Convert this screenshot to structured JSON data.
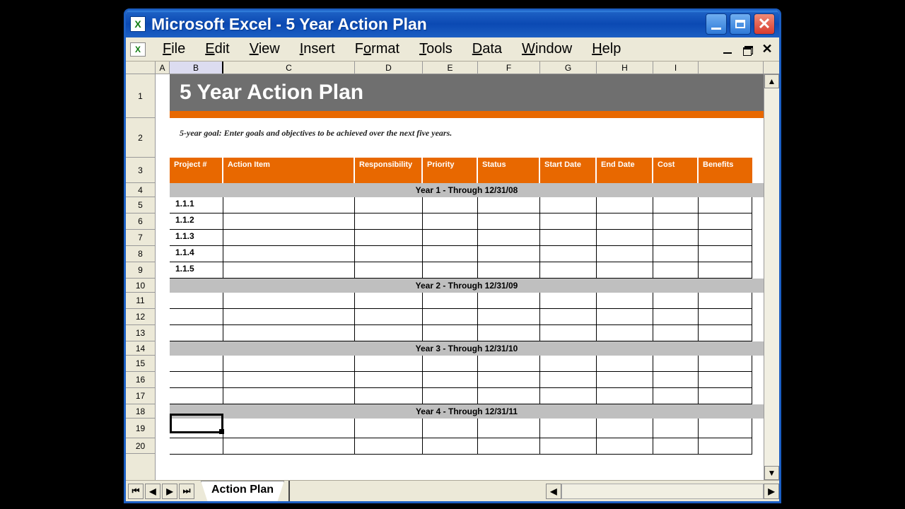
{
  "app": {
    "title": "Microsoft Excel - 5 Year Action Plan",
    "icon_letter": "X"
  },
  "menus": {
    "file": "File",
    "edit": "Edit",
    "view": "View",
    "insert": "Insert",
    "format": "Format",
    "tools": "Tools",
    "data": "Data",
    "window": "Window",
    "help": "Help"
  },
  "columns": [
    "A",
    "B",
    "C",
    "D",
    "E",
    "F",
    "G",
    "H",
    "I"
  ],
  "row_headers": [
    "1",
    "2",
    "3",
    "4",
    "5",
    "6",
    "7",
    "8",
    "9",
    "10",
    "11",
    "12",
    "13",
    "14",
    "15",
    "16",
    "17",
    "18",
    "19",
    "20"
  ],
  "sheet": {
    "title": "5 Year Action Plan",
    "subtitle": "5-year goal: Enter goals and objectives to be achieved over the next five years.",
    "col_headers": {
      "project": "Project #",
      "action": "Action Item",
      "responsible": "Responsibility",
      "priority": "Priority",
      "status": "Status",
      "start": "Start Date",
      "end": "End Date",
      "cost": "Cost",
      "benefit": "Benefits"
    },
    "year1": "Year 1 - Through 12/31/08",
    "year2": "Year 2 - Through 12/31/09",
    "year3": "Year 3 - Through 12/31/10",
    "year4": "Year 4 - Through 12/31/11",
    "projects": [
      "1.1.1",
      "1.1.2",
      "1.1.3",
      "1.1.4",
      "1.1.5"
    ]
  },
  "tab": {
    "name": "Action Plan"
  },
  "selection": {
    "cell": "B19"
  }
}
